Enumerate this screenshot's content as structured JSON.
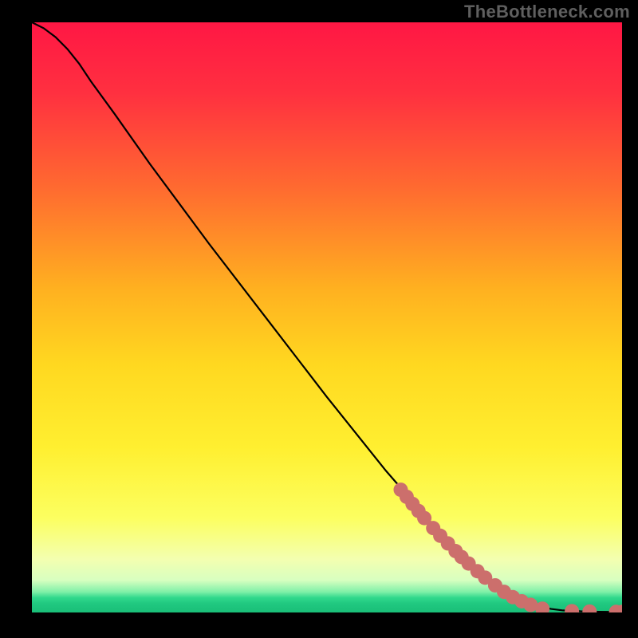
{
  "attribution": "TheBottleneck.com",
  "chart_data": {
    "type": "line",
    "title": "",
    "xlabel": "",
    "ylabel": "",
    "xlim": [
      0,
      100
    ],
    "ylim": [
      0,
      100
    ],
    "gradient_stops": [
      {
        "offset": 0.0,
        "color": "#ff1744"
      },
      {
        "offset": 0.12,
        "color": "#ff3040"
      },
      {
        "offset": 0.28,
        "color": "#ff6a30"
      },
      {
        "offset": 0.45,
        "color": "#ffb020"
      },
      {
        "offset": 0.58,
        "color": "#ffd820"
      },
      {
        "offset": 0.72,
        "color": "#ffef30"
      },
      {
        "offset": 0.84,
        "color": "#fcff60"
      },
      {
        "offset": 0.91,
        "color": "#f3ffb0"
      },
      {
        "offset": 0.945,
        "color": "#d8ffc0"
      },
      {
        "offset": 0.965,
        "color": "#80f0a8"
      },
      {
        "offset": 0.975,
        "color": "#30d88c"
      },
      {
        "offset": 0.985,
        "color": "#20c880"
      },
      {
        "offset": 1.0,
        "color": "#1abf78"
      }
    ],
    "curve": {
      "x": [
        0,
        2,
        4,
        6,
        8,
        10,
        14,
        20,
        30,
        40,
        50,
        60,
        70,
        78,
        82,
        85,
        88,
        90,
        93,
        96,
        100
      ],
      "y": [
        100,
        99,
        97.5,
        95.5,
        93,
        90,
        84.5,
        76,
        62.5,
        49.5,
        36.5,
        24,
        12.5,
        5,
        2.3,
        1.2,
        0.6,
        0.35,
        0.2,
        0.12,
        0.1
      ]
    },
    "markers": {
      "color": "#cc6f6c",
      "radius_px": 9,
      "points": [
        {
          "x": 62.5,
          "y": 20.8
        },
        {
          "x": 63.5,
          "y": 19.6
        },
        {
          "x": 64.5,
          "y": 18.4
        },
        {
          "x": 65.5,
          "y": 17.2
        },
        {
          "x": 66.5,
          "y": 16.0
        },
        {
          "x": 68.0,
          "y": 14.3
        },
        {
          "x": 69.2,
          "y": 13.0
        },
        {
          "x": 70.5,
          "y": 11.7
        },
        {
          "x": 71.8,
          "y": 10.4
        },
        {
          "x": 72.8,
          "y": 9.4
        },
        {
          "x": 74.0,
          "y": 8.3
        },
        {
          "x": 75.5,
          "y": 7.0
        },
        {
          "x": 76.8,
          "y": 5.9
        },
        {
          "x": 78.5,
          "y": 4.6
        },
        {
          "x": 80.0,
          "y": 3.5
        },
        {
          "x": 81.5,
          "y": 2.6
        },
        {
          "x": 83.0,
          "y": 1.9
        },
        {
          "x": 84.5,
          "y": 1.3
        },
        {
          "x": 86.5,
          "y": 0.65
        },
        {
          "x": 91.5,
          "y": 0.22
        },
        {
          "x": 94.5,
          "y": 0.16
        },
        {
          "x": 99.0,
          "y": 0.1
        },
        {
          "x": 100.0,
          "y": 0.1
        }
      ]
    }
  }
}
